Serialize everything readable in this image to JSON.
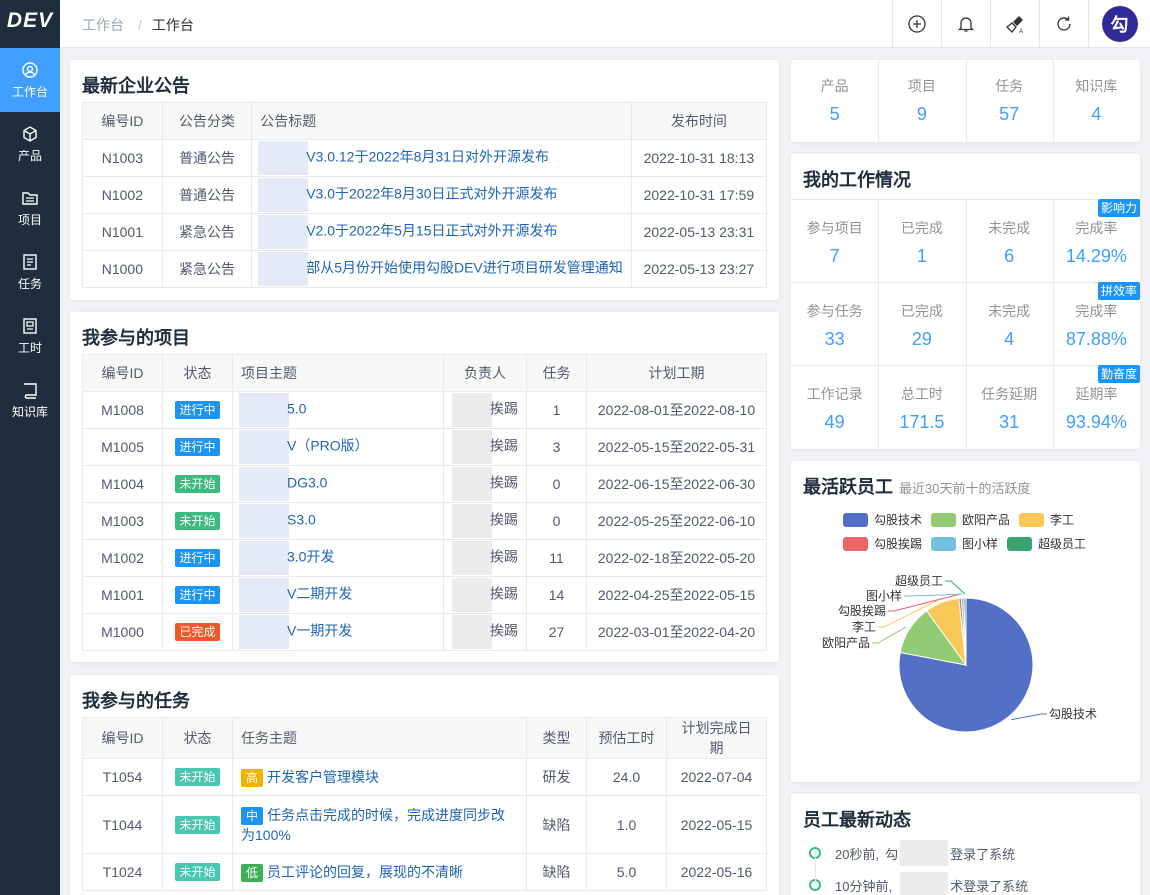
{
  "app": {
    "logo": "DEV"
  },
  "sidebar": {
    "items": [
      {
        "label": "工作台",
        "icon": "dashboard-icon",
        "active": true
      },
      {
        "label": "产品",
        "icon": "cube-icon"
      },
      {
        "label": "项目",
        "icon": "folder-icon"
      },
      {
        "label": "任务",
        "icon": "task-list-icon"
      },
      {
        "label": "工时",
        "icon": "timesheet-icon"
      },
      {
        "label": "知识库",
        "icon": "book-icon"
      }
    ]
  },
  "header": {
    "breadcrumb": [
      "工作台",
      "工作台"
    ],
    "actions": [
      "plus-circle-icon",
      "bell-icon",
      "brush-icon",
      "refresh-icon"
    ],
    "avatar_text": "勾"
  },
  "announcements": {
    "title": "最新企业公告",
    "columns": [
      "编号ID",
      "公告分类",
      "公告标题",
      "发布时间"
    ],
    "rows": [
      {
        "id": "N1003",
        "category": "普通公告",
        "title": "V3.0.12于2022年8月31日对外开源发布",
        "time": "2022-10-31 18:13"
      },
      {
        "id": "N1002",
        "category": "普通公告",
        "title": "V3.0于2022年8月30日正式对外开源发布",
        "time": "2022-10-31 17:59"
      },
      {
        "id": "N1001",
        "category": "紧急公告",
        "title": "V2.0于2022年5月15日正式对外开源发布",
        "time": "2022-05-13 23:31"
      },
      {
        "id": "N1000",
        "category": "紧急公告",
        "title": "部从5月份开始使用勾股DEV进行项目研发管理通知",
        "time": "2022-05-13 23:27"
      }
    ]
  },
  "projects": {
    "title": "我参与的项目",
    "columns": [
      "编号ID",
      "状态",
      "项目主题",
      "负责人",
      "任务",
      "计划工期"
    ],
    "rows": [
      {
        "id": "M1008",
        "status": "进行中",
        "status_type": "run",
        "name": "5.0",
        "owner": "挨踢",
        "tasks": "1",
        "period": "2022-08-01至2022-08-10"
      },
      {
        "id": "M1005",
        "status": "进行中",
        "status_type": "run",
        "name": "V（PRO版）",
        "owner": "挨踢",
        "tasks": "3",
        "period": "2022-05-15至2022-05-31"
      },
      {
        "id": "M1004",
        "status": "未开始",
        "status_type": "todo",
        "name": "DG3.0",
        "owner": "挨踢",
        "tasks": "0",
        "period": "2022-06-15至2022-06-30"
      },
      {
        "id": "M1003",
        "status": "未开始",
        "status_type": "todo",
        "name": "S3.0",
        "owner": "挨踢",
        "tasks": "0",
        "period": "2022-05-25至2022-06-10"
      },
      {
        "id": "M1002",
        "status": "进行中",
        "status_type": "run",
        "name": "3.0开发",
        "owner": "挨踢",
        "tasks": "11",
        "period": "2022-02-18至2022-05-20"
      },
      {
        "id": "M1001",
        "status": "进行中",
        "status_type": "run",
        "name": "V二期开发",
        "owner": "挨踢",
        "tasks": "14",
        "period": "2022-04-25至2022-05-15"
      },
      {
        "id": "M1000",
        "status": "已完成",
        "status_type": "done",
        "name": "V一期开发",
        "owner": "挨踢",
        "tasks": "27",
        "period": "2022-03-01至2022-04-20"
      }
    ]
  },
  "tasks": {
    "title": "我参与的任务",
    "columns": [
      "编号ID",
      "状态",
      "任务主题",
      "类型",
      "预估工时",
      "计划完成日期"
    ],
    "rows": [
      {
        "id": "T1054",
        "status": "未开始",
        "priority": "高",
        "priority_type": "h",
        "name": "开发客户管理模块",
        "type": "研发",
        "hours": "24.0",
        "date": "2022-07-04"
      },
      {
        "id": "T1044",
        "status": "未开始",
        "priority": "中",
        "priority_type": "m",
        "name": "任务点击完成的时候，完成进度同步改为100%",
        "type": "缺陷",
        "hours": "1.0",
        "date": "2022-05-15"
      },
      {
        "id": "T1024",
        "status": "未开始",
        "priority": "低",
        "priority_type": "l",
        "name": "员工评论的回复，展现的不清晰",
        "type": "缺陷",
        "hours": "5.0",
        "date": "2022-05-16"
      }
    ]
  },
  "summary": {
    "items": [
      {
        "label": "产品",
        "value": "5"
      },
      {
        "label": "项目",
        "value": "9"
      },
      {
        "label": "任务",
        "value": "57"
      },
      {
        "label": "知识库",
        "value": "4"
      }
    ]
  },
  "work": {
    "title": "我的工作情况",
    "rows": [
      {
        "badge": "影响力",
        "cells": [
          {
            "label": "参与项目",
            "value": "7"
          },
          {
            "label": "已完成",
            "value": "1"
          },
          {
            "label": "未完成",
            "value": "6"
          },
          {
            "label": "完成率",
            "value": "14.29%"
          }
        ]
      },
      {
        "badge": "拼效率",
        "cells": [
          {
            "label": "参与任务",
            "value": "33"
          },
          {
            "label": "已完成",
            "value": "29"
          },
          {
            "label": "未完成",
            "value": "4"
          },
          {
            "label": "完成率",
            "value": "87.88%"
          }
        ]
      },
      {
        "badge": "勤奋度",
        "cells": [
          {
            "label": "工作记录",
            "value": "49"
          },
          {
            "label": "总工时",
            "value": "171.5"
          },
          {
            "label": "任务延期",
            "value": "31"
          },
          {
            "label": "延期率",
            "value": "93.94%"
          }
        ]
      }
    ]
  },
  "active": {
    "title": "最活跃员工",
    "subtitle": "最近30天前十的活跃度"
  },
  "chart_data": {
    "type": "pie",
    "series": [
      {
        "name": "勾股技术",
        "value": 78,
        "color": "#5470c6"
      },
      {
        "name": "欧阳产品",
        "value": 12,
        "color": "#91cc75"
      },
      {
        "name": "李工",
        "value": 8.3,
        "color": "#fac858"
      },
      {
        "name": "勾股挨踢",
        "value": 0.6,
        "color": "#ee6666"
      },
      {
        "name": "图小样",
        "value": 0.6,
        "color": "#73c0de"
      },
      {
        "name": "超级员工",
        "value": 0.5,
        "color": "#3ba272"
      }
    ]
  },
  "activity": {
    "title": "员工最新动态",
    "items": [
      {
        "time": "20秒前,",
        "text": "登录了系统",
        "who": "勾"
      },
      {
        "time": "10分钟前,",
        "text": "术登录了系统",
        "who": ""
      }
    ]
  }
}
